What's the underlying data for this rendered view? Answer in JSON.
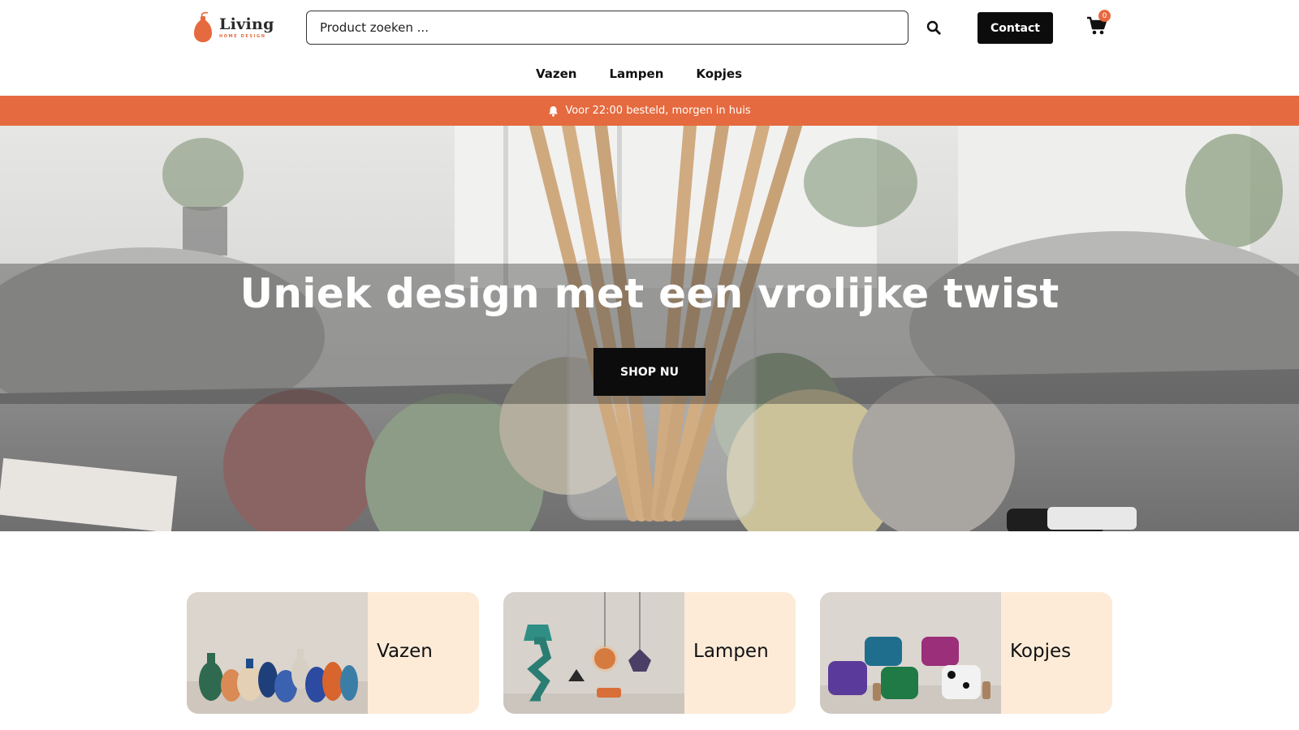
{
  "header": {
    "logo": {
      "word": "Living",
      "subtitle": "HOME DESIGN",
      "icon": "vase-logo-icon",
      "color": "#e56a3f"
    },
    "search": {
      "placeholder": "Product zoeken ...",
      "icon": "search-icon"
    },
    "contact_label": "Contact",
    "cart": {
      "icon": "cart-icon",
      "count": "0"
    },
    "nav": [
      {
        "label": "Vazen"
      },
      {
        "label": "Lampen"
      },
      {
        "label": "Kopjes"
      }
    ]
  },
  "announcement": {
    "icon": "bell-icon",
    "text": "Voor 22:00 besteld, morgen in huis",
    "background": "#e56a3f"
  },
  "hero": {
    "title": "Uniek design met een vrolijke twist",
    "cta_label": "SHOP NU"
  },
  "categories": [
    {
      "label": "Vazen",
      "image": "vases-photo"
    },
    {
      "label": "Lampen",
      "image": "lamps-photo"
    },
    {
      "label": "Kopjes",
      "image": "cups-photo"
    }
  ],
  "colors": {
    "accent": "#e56a3f",
    "button": "#0c0c0c",
    "card_bg": "#fdebd8"
  }
}
